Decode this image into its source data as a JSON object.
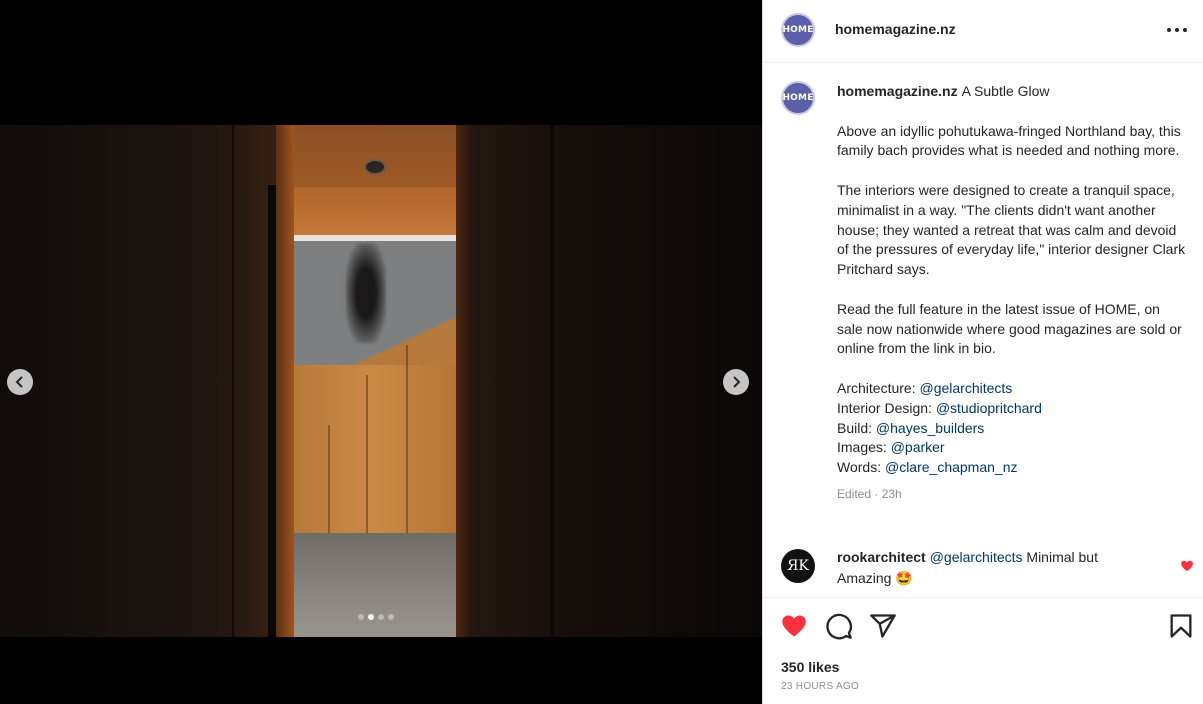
{
  "post": {
    "username": "homemagazine.nz",
    "avatar_text": "HOME",
    "more_options_icon": "more-horizontal-icon"
  },
  "media": {
    "carousel_dots": 4,
    "active_dot": 1,
    "prev_icon": "chevron-left-icon",
    "next_icon": "chevron-right-icon"
  },
  "caption": {
    "username": "homemagazine.nz",
    "title": "A Subtle Glow",
    "paragraph1": "Above an idyllic pohutukawa-fringed Northland bay, this family bach provides what is needed and nothing more.",
    "paragraph2": "The interiors were designed to create a tranquil space, minimalist in a way. \"The clients didn't want another house; they wanted a retreat that was calm and devoid of the pressures of everyday life,\" interior designer Clark Pritchard says.",
    "paragraph3": "Read the full feature in the latest issue of HOME, on sale now nationwide where good magazines are sold or online from the link in bio.",
    "credits": [
      {
        "label": "Architecture:",
        "handle": "@gelarchitects"
      },
      {
        "label": "Interior Design:",
        "handle": "@studiopritchard"
      },
      {
        "label": "Build:",
        "handle": "@hayes_builders"
      },
      {
        "label": "Images:",
        "handle": "@parker"
      },
      {
        "label": "Words:",
        "handle": "@clare_chapman_nz"
      }
    ],
    "meta": "Edited · 23h"
  },
  "comment": {
    "avatar_text": "ЯK",
    "username": "rookarchitect",
    "mention": "@gelarchitects",
    "text": "Minimal but Amazing 🤩"
  },
  "actions": {
    "likes": "350 likes",
    "time_ago": "23 HOURS AGO",
    "like_color": "#ff3040"
  }
}
